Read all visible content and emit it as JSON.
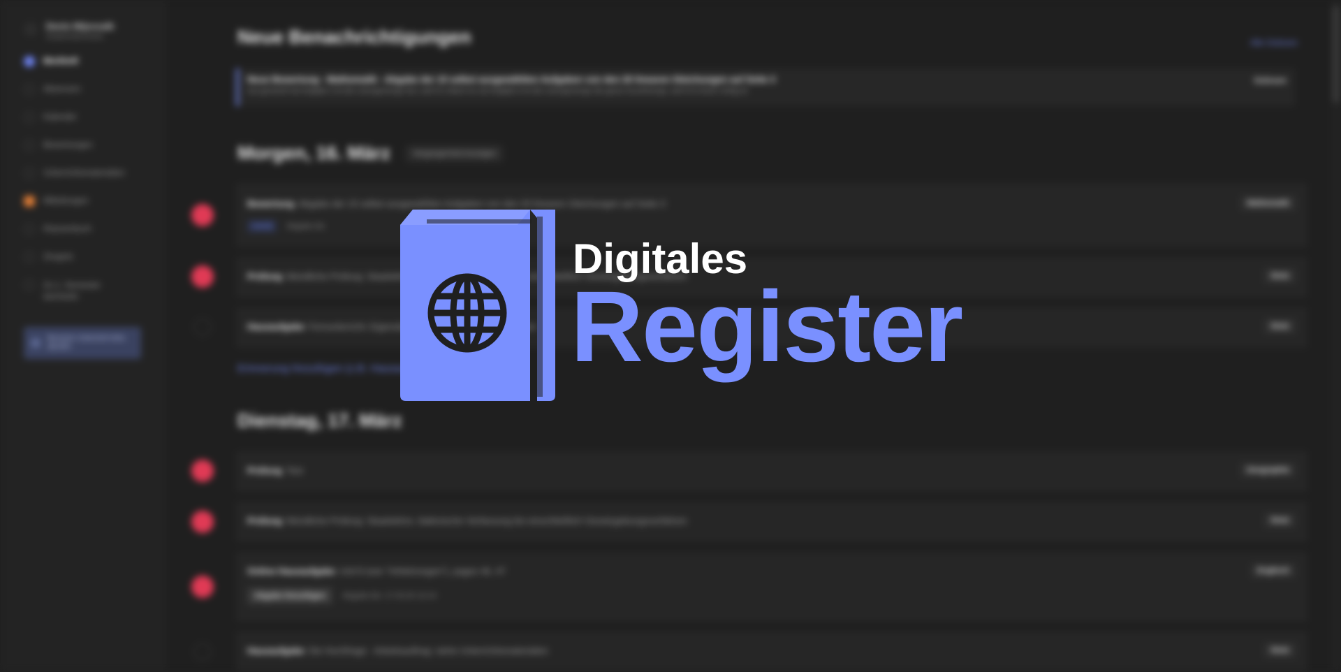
{
  "sidebar": {
    "user_name": "Denis Mijovsalk",
    "user_role": "Studierendenmeister",
    "items": [
      {
        "label": "Merkheft"
      },
      {
        "label": "Absenzen"
      },
      {
        "label": "Kalender"
      },
      {
        "label": "Bewertungen"
      },
      {
        "label": "Unterrichtsmaterialien"
      },
      {
        "label": "Mitteilungen"
      },
      {
        "label": "Klassenbuch"
      },
      {
        "label": "Zeugnis"
      },
      {
        "label": "Zu 1. Semester wechseln"
      }
    ],
    "card_label": "Benutzer Unterricht-Infos abrufen"
  },
  "notifications": {
    "heading": "Neue Benachrichtigungen",
    "read_all": "Alle Gelesen",
    "items": [
      {
        "title": "Neue Bewertung - Mathematik - Abgabe der 10 selbst ausgewählten Aufgaben von den 20 linearen Gleichungen auf Seite 3",
        "text": "Gut gemacht! bei Aufgabe 3 ist die Lösungsmenge leer, weil 0=x falsch ist, bei Aufgabe 8 ist die Lösungsmenge die ganze Grundmenge, weil 0=0 immer richtig ist",
        "action": "Gelesen"
      }
    ]
  },
  "days": [
    {
      "heading": "Morgen, 16. März",
      "chip": "Vergangenheit Anzeigen",
      "entries": [
        {
          "type": "Bewertung",
          "text": "Abgabe der 10 selbst ausgewählten Aufgaben von den 20 linearen Gleichungen auf Seite 3",
          "subject": "Mathematik",
          "tag": "HAKB",
          "meta": "Abgabe bis",
          "dot": "red"
        },
        {
          "type": "Prüfung",
          "text": "Mündliche Prüfung: Staatslehre, Italienische Verfassung bis einschließlich Gesetzgebungsverfahren",
          "subject": "Stotz",
          "dot": "red"
        },
        {
          "type": "Hausaufgabe",
          "text": "Fernunterricht: Eigenständig die Seiten 19-20 bearbeiten",
          "subject": "Stotz",
          "dot": "empty"
        }
      ],
      "reminder": "Erinnerung hinzufügen (z.B. Hausaufgabe)"
    },
    {
      "heading": "Dienstag, 17. März",
      "entries": [
        {
          "type": "Prüfung",
          "text": "Test",
          "subject": "Geographie",
          "dot": "red"
        },
        {
          "type": "Prüfung",
          "text": "Mündliche Prüfung: Staatslehre, Italienische Verfassung bis einschließlich Gesetzgebungsverfahren",
          "subject": "Stotz",
          "dot": "red"
        },
        {
          "type": "Online Hausaufgabe",
          "text": "Unit 8 (see \"Infobörsegen\"), pages 46, 47",
          "subject": "Englisch",
          "button": "Abgabe hinzufügen",
          "meta": "Abgabe bis: 17.03.20 12:14",
          "dot": "red"
        },
        {
          "type": "Hausaufgabe",
          "text": "Die Hochfrage - Arbeitsauftrag: siehe Unterrichtsmaterialien",
          "subject": "Stotz",
          "dot": "empty"
        }
      ]
    }
  ],
  "logo": {
    "line1": "Digitales",
    "line2": "Register",
    "icon": "passport-globe-icon",
    "accent": "#7a90ff"
  }
}
